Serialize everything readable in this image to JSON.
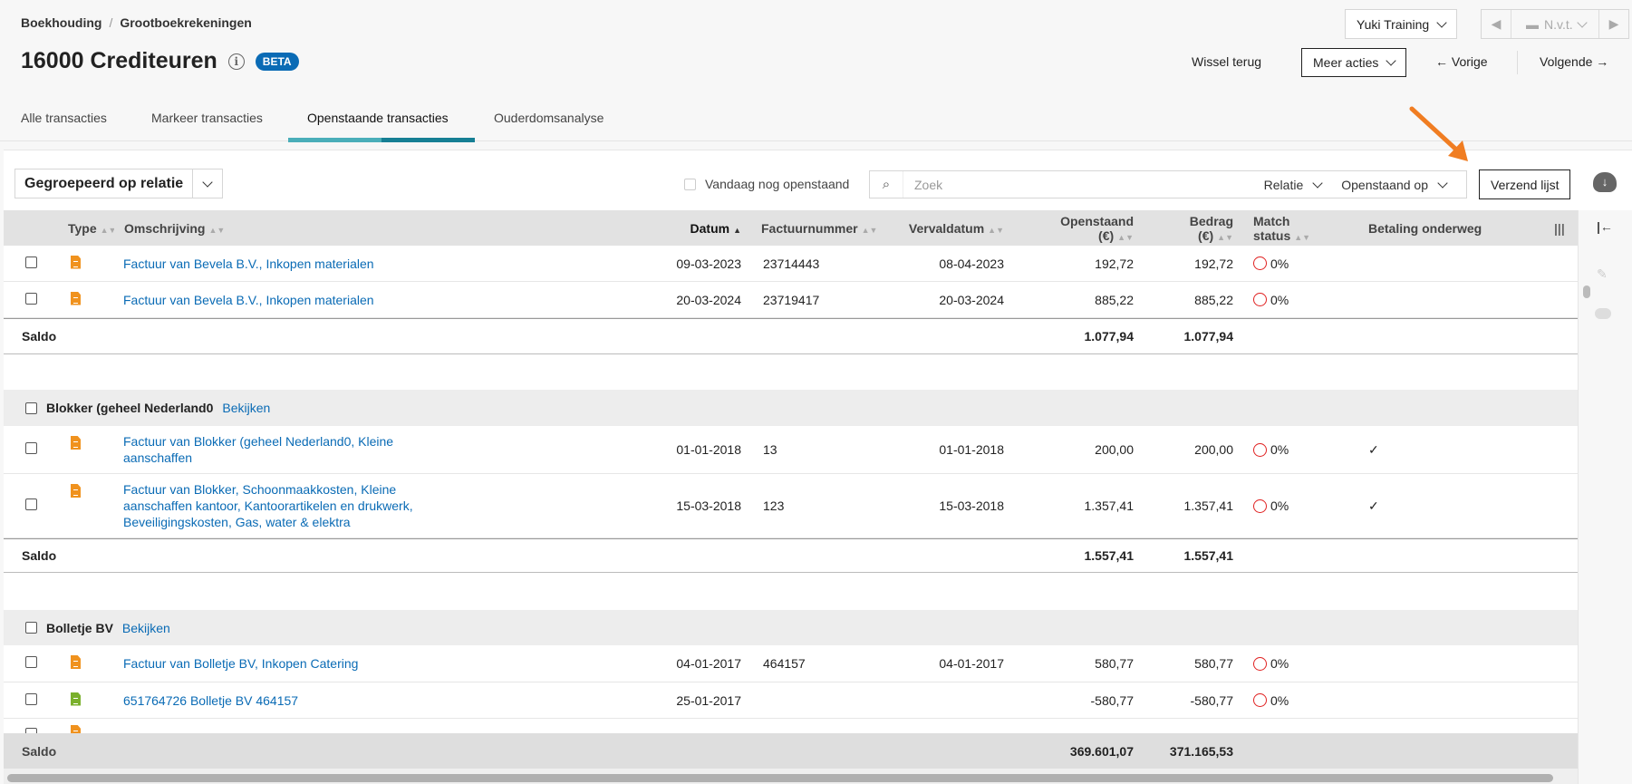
{
  "breadcrumb": [
    "Boekhouding",
    "Grootboekrekeningen"
  ],
  "title": "16000 Crediteuren",
  "badge": "BETA",
  "header": {
    "company": "Yuki Training",
    "period": "N.v.t.",
    "switch_back": "Wissel terug",
    "more_actions": "Meer acties",
    "prev": "Vorige",
    "next": "Volgende"
  },
  "tabs": [
    "Alle transacties",
    "Markeer transacties",
    "Openstaande transacties",
    "Ouderdomsanalyse"
  ],
  "toolbar": {
    "grouping": "Gegroepeerd op relatie",
    "today_open": "Vandaag nog openstaand",
    "search_placeholder": "Zoek",
    "filter_relation": "Relatie",
    "filter_open_on": "Openstaand op",
    "send_list": "Verzend lijst"
  },
  "columns": [
    "Type",
    "Omschrijving",
    "Datum",
    "Factuurnummer",
    "Vervaldatum",
    "Openstaand (€)",
    "Bedrag (€)",
    "Match status",
    "Betaling onderweg"
  ],
  "saldo_label": "Saldo",
  "view_label": "Bekijken",
  "groups": [
    {
      "name": "",
      "rows": [
        {
          "desc": "Factuur van  Bevela B.V., Inkopen materialen",
          "date": "09-03-2023",
          "invoice": "23714443",
          "due": "08-04-2023",
          "open": "192,72",
          "amount": "192,72",
          "match": "0%",
          "paid": ""
        },
        {
          "desc": "Factuur van  Bevela B.V., Inkopen materialen",
          "date": "20-03-2024",
          "invoice": "23719417",
          "due": "20-03-2024",
          "open": "885,22",
          "amount": "885,22",
          "match": "0%",
          "paid": ""
        }
      ],
      "saldo_open": "1.077,94",
      "saldo_amount": "1.077,94"
    },
    {
      "name": "Blokker (geheel Nederland0",
      "rows": [
        {
          "desc": "Factuur van Blokker (geheel Nederland0, Kleine aanschaffen",
          "date": "01-01-2018",
          "invoice": "13",
          "due": "01-01-2018",
          "open": "200,00",
          "amount": "200,00",
          "match": "0%",
          "paid": "✓"
        },
        {
          "desc": "Factuur van Blokker, Schoonmaakkosten, Kleine aanschaffen kantoor, Kantoorartikelen en drukwerk, Beveiligingskosten, Gas, water & elektra",
          "date": "15-03-2018",
          "invoice": "123",
          "due": "15-03-2018",
          "open": "1.357,41",
          "amount": "1.357,41",
          "match": "0%",
          "paid": "✓"
        }
      ],
      "saldo_open": "1.557,41",
      "saldo_amount": "1.557,41"
    },
    {
      "name": "Bolletje BV",
      "rows": [
        {
          "desc": "Factuur van Bolletje BV, Inkopen Catering",
          "date": "04-01-2017",
          "invoice": "464157",
          "due": "04-01-2017",
          "open": "580,77",
          "amount": "580,77",
          "match": "0%",
          "paid": ""
        },
        {
          "desc": "651764726 Bolletje BV 464157",
          "date": "25-01-2017",
          "invoice": "",
          "due": "",
          "open": "-580,77",
          "amount": "-580,77",
          "match": "0%",
          "paid": ""
        }
      ]
    }
  ],
  "total": {
    "open": "369.601,07",
    "amount": "371.165,53"
  },
  "colors": {
    "accent": "#0a6bb5",
    "arrow": "#f07d22",
    "invoice": "#f0921e",
    "payment": "#7ab02c",
    "match": "#e02020"
  }
}
